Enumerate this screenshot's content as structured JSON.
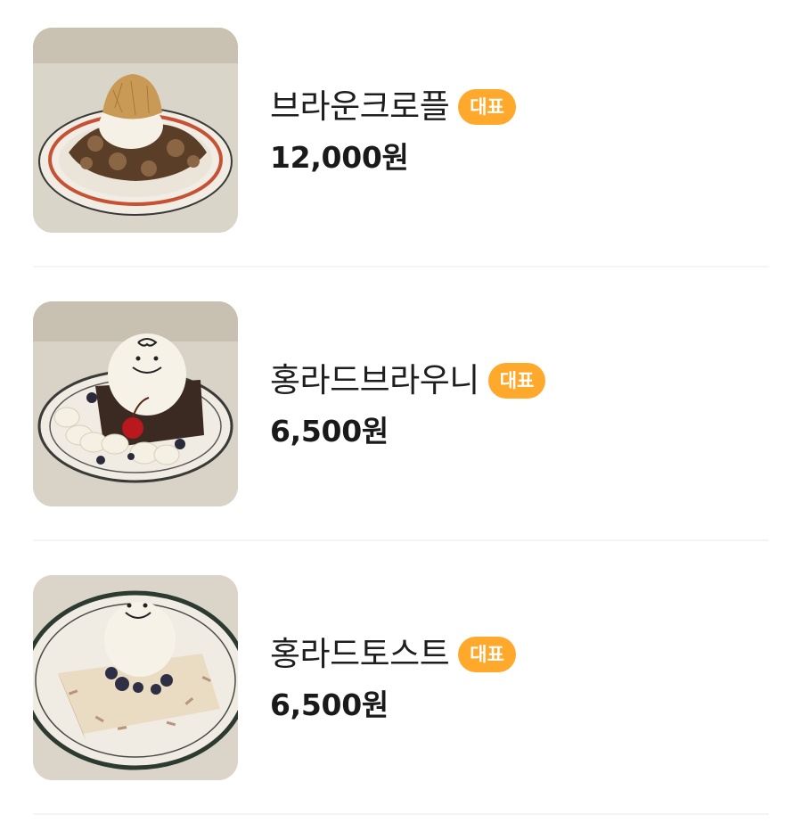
{
  "menu": {
    "items": [
      {
        "name": "브라운크로플",
        "badge": "대표",
        "price": "12,000원"
      },
      {
        "name": "홍라드브라우니",
        "badge": "대표",
        "price": "6,500원"
      },
      {
        "name": "홍라드토스트",
        "badge": "대표",
        "price": "6,500원"
      }
    ]
  },
  "colors": {
    "badge": "#ffa92c",
    "photo_background": "#d9d5c9",
    "divider": "#f4f4f4"
  }
}
